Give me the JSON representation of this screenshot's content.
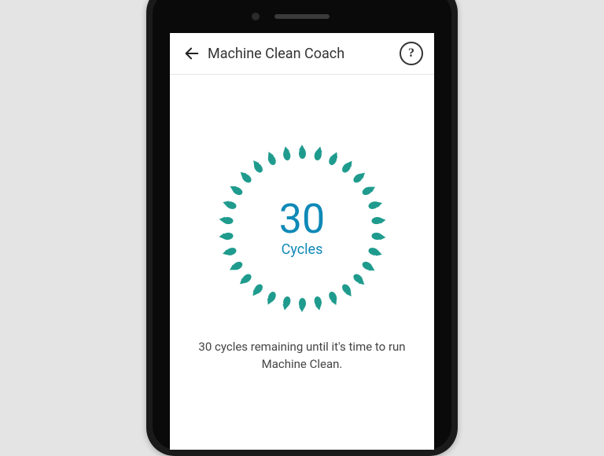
{
  "header": {
    "title": "Machine Clean Coach",
    "help_glyph": "?"
  },
  "counter": {
    "value": "30",
    "unit": "Cycles"
  },
  "message": "30 cycles remaining until it's time to run Machine Clean.",
  "ring": {
    "droplet_count": 30,
    "color": "#1f9b8e"
  },
  "accent_color": "#0f89b7"
}
